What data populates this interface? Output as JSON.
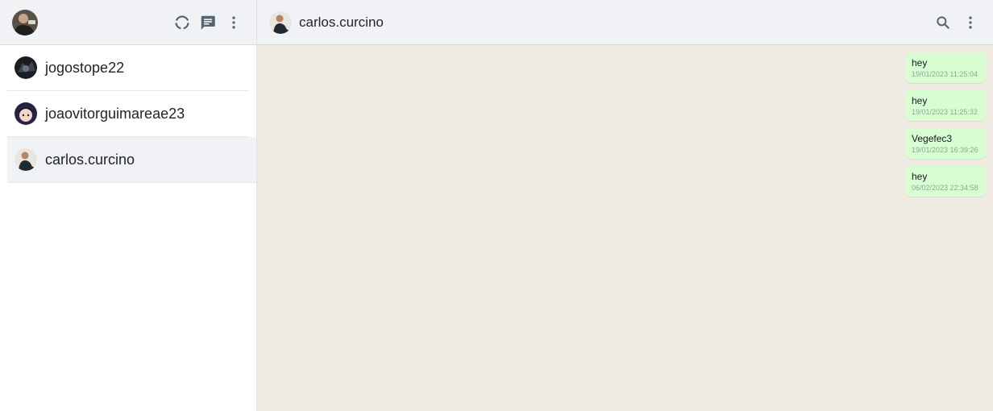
{
  "sidebar": {
    "header": {
      "icons": [
        "status-icon",
        "new-chat-icon",
        "menu-icon"
      ]
    },
    "chats": [
      {
        "name": "jogostope22",
        "active": false
      },
      {
        "name": "joaovitorguimareae23",
        "active": false
      },
      {
        "name": "carlos.curcino",
        "active": true
      }
    ]
  },
  "conversation": {
    "contact_name": "carlos.curcino",
    "header_icons": [
      "search-icon",
      "menu-icon"
    ],
    "messages": [
      {
        "text": "hey",
        "time": "19/01/2023 11:25:04"
      },
      {
        "text": "hey",
        "time": "19/01/2023 11:25:32"
      },
      {
        "text": "Vegefec3",
        "time": "19/01/2023 16:39:26"
      },
      {
        "text": "hey",
        "time": "06/02/2023 22:34:58"
      }
    ]
  },
  "colors": {
    "header_bg": "#f0f2f5",
    "chat_bg": "#efeae2",
    "outgoing_bubble": "#d9fdd3",
    "icon": "#54656f"
  }
}
